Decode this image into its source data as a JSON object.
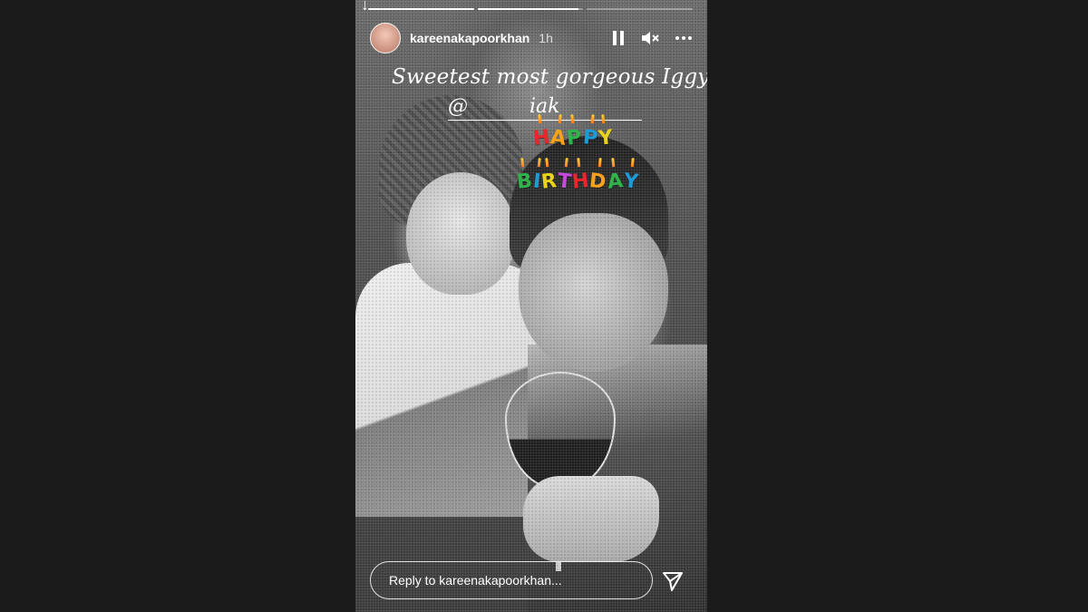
{
  "story": {
    "progress": [
      1,
      0.95,
      0
    ],
    "user": {
      "username": "kareenakapoorkhan",
      "time": "1h"
    },
    "controls": {
      "pause": "pause-icon",
      "mute": "muted-speaker-icon",
      "more": "more-icon"
    },
    "caption": {
      "text": "Sweetest most gorgeous Iggy",
      "emoji": "❤"
    },
    "mention": {
      "at": "@",
      "tail": "iak"
    },
    "sticker": {
      "happy": [
        "H",
        "A",
        "P",
        "P",
        "Y"
      ],
      "birthday": [
        "B",
        "I",
        "R",
        "T",
        "H",
        "D",
        "A",
        "Y"
      ]
    },
    "reply": {
      "placeholder": "Reply to kareenakapoorkhan..."
    }
  },
  "colors": {
    "sticker_letters": [
      "#e8262b",
      "#f7a21b",
      "#2fb34a",
      "#1e9ad6",
      "#e8d21b",
      "#c44bd8"
    ],
    "heart": "#e0202a"
  }
}
